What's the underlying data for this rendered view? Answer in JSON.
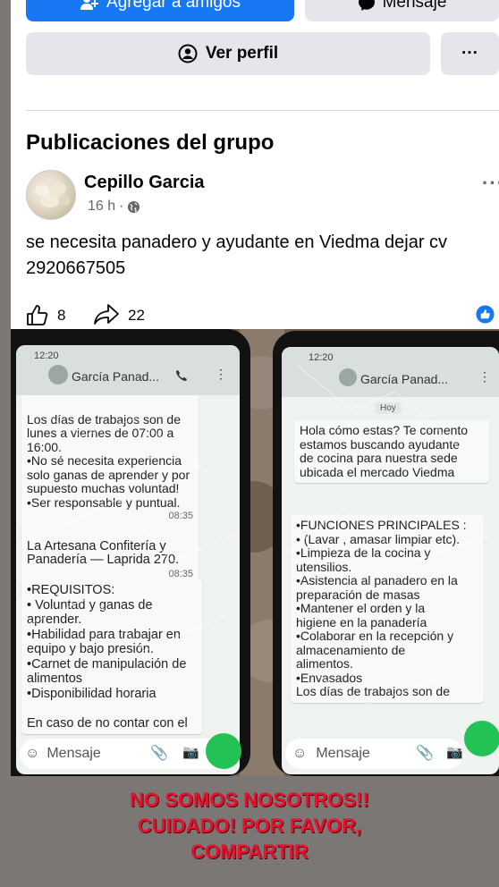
{
  "profile_actions": {
    "add_friend": "Agregar a amigos",
    "message": "Mensaje",
    "view_profile": "Ver perfil",
    "more": "···"
  },
  "section_title": "Publicaciones del grupo",
  "post": {
    "author": "Cepillo Garcia",
    "time": "16 h",
    "separator": "·",
    "text": "se necesita panadero y ayudante en  Viedma dejar cv\n2920667505",
    "likes": "8",
    "shares": "22",
    "more": "···"
  },
  "phone_left": {
    "status_time": "12:20",
    "contact": "García Panad...",
    "msg1": "Los días de trabajos son de\nlunes a viernes de 07:00 a\n16:00.\n•No sé necesita experiencia\nsolo ganas de aprender y por\nsupuesto muchas voluntad!\n•Ser responsable y puntual.",
    "msg1_time": "08:35",
    "msg2": "La Artesana Confitería y\nPanadería — Laprida 270.",
    "msg2_time": "08:35",
    "msg3": "•REQUISITOS:\n• Voluntad y ganas de\naprender.\n•Habilidad para trabajar en\nequipo y bajo presión.\n•Carnet de manipulación de\nalimentos\n•Disponibilidad horaria\n\nEn caso de no contar con el",
    "input_placeholder": "Mensaje"
  },
  "phone_right": {
    "status_time": "12:20",
    "contact": "García Panad...",
    "date_chip": "Hoy",
    "msg1": "Hola cómo estas? Te comento\nestamos buscando ayudante\nde cocina para nuestra sede\nubicada el mercado Viedma",
    "msg2": "•FUNCIONES PRINCIPALES :\n• (Lavar , amasar limpiar etc).\n•Limpieza de la cocina y\nutensilios.\n•Asistencia al panadero en la\npreparación de masas\n•Mantener el orden y la\nhigiene en la panadería\n•Colaborar en la recepción y\nalmacenamiento de\nalimentos.\n•Envasados\nLos días de trabajos son de",
    "input_placeholder": "Mensaje"
  },
  "warning": {
    "line1": "NO SOMOS NOSOTROS!!",
    "line2": "CUIDADO! POR FAVOR,",
    "line3": "COMPARTIR"
  },
  "colors": {
    "facebook_blue": "#1877f2",
    "warning_red": "#e8112d",
    "whatsapp_green": "#23c257"
  }
}
